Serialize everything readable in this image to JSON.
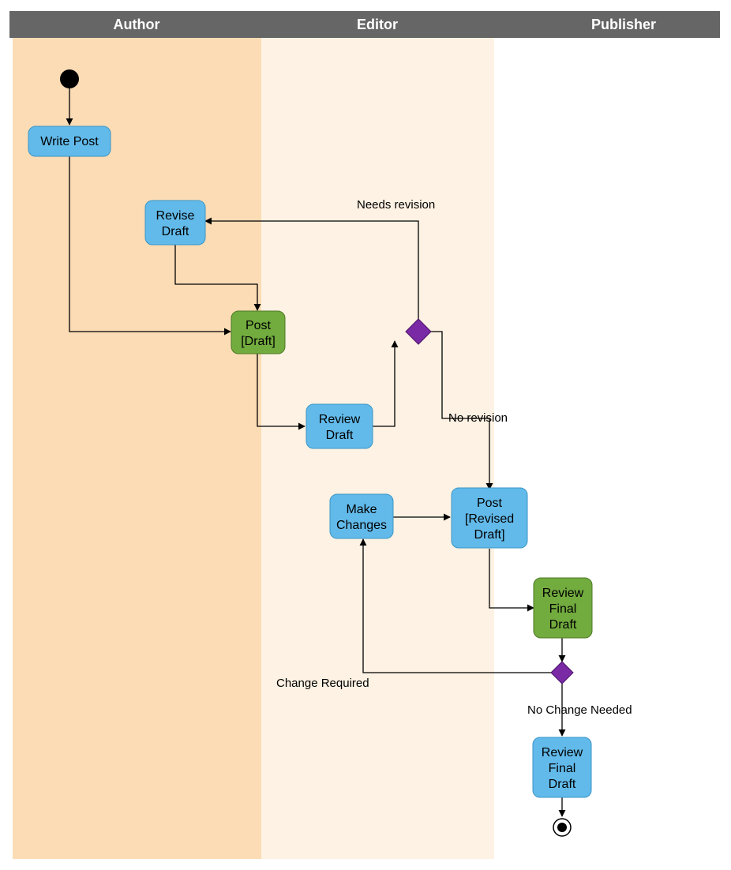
{
  "swimlanes": {
    "author": "Author",
    "editor": "Editor",
    "publisher": "Publisher"
  },
  "nodes": {
    "writePost": "Write Post",
    "reviseDraft1": "Revise",
    "reviseDraft2": "Draft",
    "postDraft1": "Post",
    "postDraft2": "[Draft]",
    "reviewDraft1": "Review",
    "reviewDraft2": "Draft",
    "makeChanges1": "Make",
    "makeChanges2": "Changes",
    "postRevised1": "Post",
    "postRevised2": "[Revised",
    "postRevised3": "Draft]",
    "reviewFinalA1": "Review",
    "reviewFinalA2": "Final",
    "reviewFinalA3": "Draft",
    "reviewFinalB1": "Review",
    "reviewFinalB2": "Final",
    "reviewFinalB3": "Draft"
  },
  "edges": {
    "needsRevision": "Needs revision",
    "noRevision": "No revision",
    "changeRequired": "Change Required",
    "noChangeNeeded": "No Change Needed"
  },
  "chart_data": {
    "type": "activity-diagram",
    "title": "",
    "swimlanes": [
      "Author",
      "Editor",
      "Publisher"
    ],
    "nodes": [
      {
        "id": "start",
        "type": "start",
        "lane": "Author",
        "label": ""
      },
      {
        "id": "writePost",
        "type": "activity",
        "lane": "Author",
        "label": "Write Post"
      },
      {
        "id": "reviseDraft",
        "type": "activity",
        "lane": "Author",
        "label": "Revise Draft"
      },
      {
        "id": "postDraft",
        "type": "object",
        "lane": "Author",
        "label": "Post [Draft]"
      },
      {
        "id": "reviewDraft",
        "type": "activity",
        "lane": "Editor",
        "label": "Review Draft"
      },
      {
        "id": "decision1",
        "type": "decision",
        "lane": "Editor",
        "label": ""
      },
      {
        "id": "makeChanges",
        "type": "activity",
        "lane": "Editor",
        "label": "Make Changes"
      },
      {
        "id": "postRevised",
        "type": "object",
        "lane": "Editor",
        "label": "Post [Revised Draft]"
      },
      {
        "id": "reviewFinal",
        "type": "activity",
        "lane": "Publisher",
        "label": "Review Final Draft"
      },
      {
        "id": "decision2",
        "type": "decision",
        "lane": "Publisher",
        "label": ""
      },
      {
        "id": "reviewFinal2",
        "type": "activity",
        "lane": "Publisher",
        "label": "Review Final Draft"
      },
      {
        "id": "end",
        "type": "end",
        "lane": "Publisher",
        "label": ""
      }
    ],
    "edges": [
      {
        "from": "start",
        "to": "writePost",
        "label": ""
      },
      {
        "from": "writePost",
        "to": "postDraft",
        "label": ""
      },
      {
        "from": "reviseDraft",
        "to": "postDraft",
        "label": ""
      },
      {
        "from": "postDraft",
        "to": "reviewDraft",
        "label": ""
      },
      {
        "from": "reviewDraft",
        "to": "decision1",
        "label": ""
      },
      {
        "from": "decision1",
        "to": "reviseDraft",
        "label": "Needs revision"
      },
      {
        "from": "decision1",
        "to": "postRevised",
        "label": "No revision"
      },
      {
        "from": "makeChanges",
        "to": "postRevised",
        "label": ""
      },
      {
        "from": "postRevised",
        "to": "reviewFinal",
        "label": ""
      },
      {
        "from": "reviewFinal",
        "to": "decision2",
        "label": ""
      },
      {
        "from": "decision2",
        "to": "makeChanges",
        "label": "Change Required"
      },
      {
        "from": "decision2",
        "to": "reviewFinal2",
        "label": "No Change Needed"
      },
      {
        "from": "reviewFinal2",
        "to": "end",
        "label": ""
      }
    ]
  }
}
